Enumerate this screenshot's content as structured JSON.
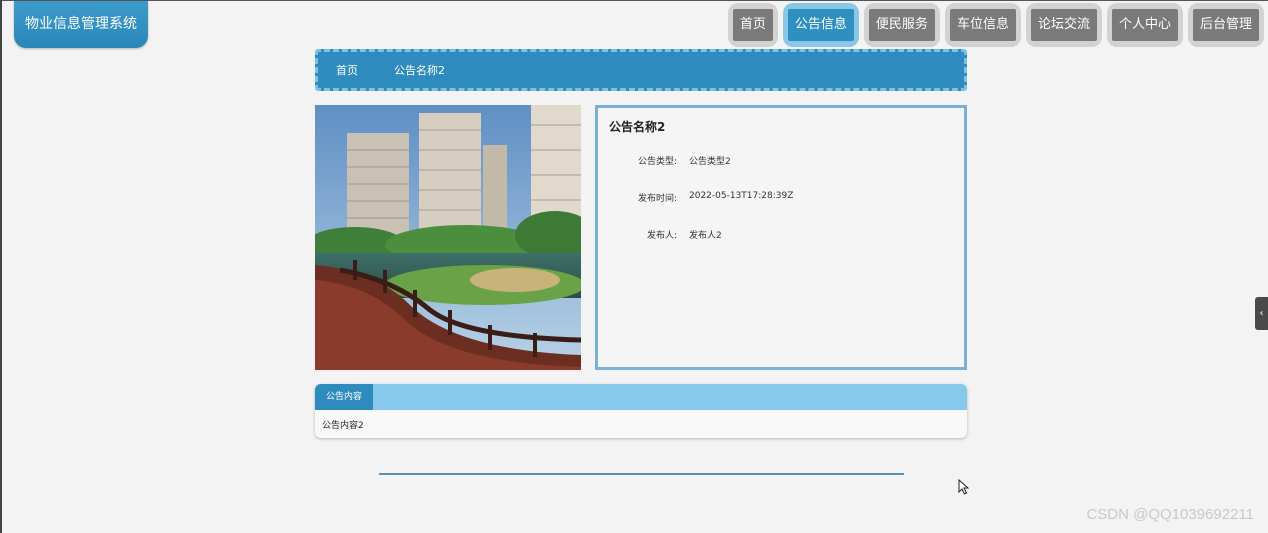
{
  "app": {
    "title": "物业信息管理系统"
  },
  "nav": {
    "items": [
      {
        "label": "首页"
      },
      {
        "label": "公告信息"
      },
      {
        "label": "便民服务"
      },
      {
        "label": "车位信息"
      },
      {
        "label": "论坛交流"
      },
      {
        "label": "个人中心"
      },
      {
        "label": "后台管理"
      }
    ],
    "active_index": 1
  },
  "breadcrumb": {
    "home": "首页",
    "current": "公告名称2"
  },
  "detail": {
    "title": "公告名称2",
    "type_label": "公告类型:",
    "type_value": "公告类型2",
    "time_label": "发布时间:",
    "time_value": "2022-05-13T17:28:39Z",
    "publisher_label": "发布人:",
    "publisher_value": "发布人2"
  },
  "content": {
    "tab_label": "公告内容",
    "text": "公告内容2"
  },
  "watermark": "CSDN @QQ1039692211",
  "colors": {
    "primary": "#2f8bbd",
    "light": "#86c9ec",
    "nav_inactive": "#7a7a7a"
  },
  "icons": {
    "side_toggle": "chevron-left-icon",
    "cursor": "mouse-pointer-icon"
  }
}
